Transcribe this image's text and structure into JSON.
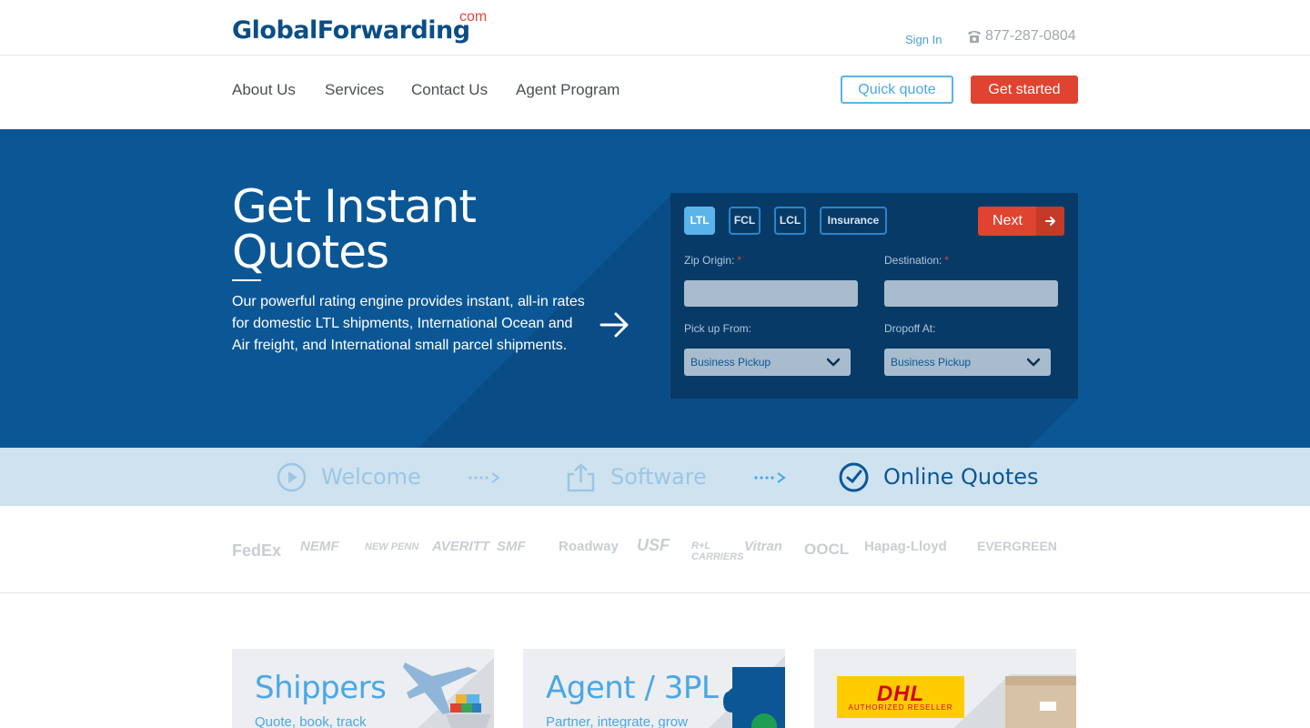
{
  "header": {
    "logo_text": "GlobalForwarding",
    "logo_suffix": "com",
    "sign_in": "Sign In",
    "phone": "877-287-0804"
  },
  "nav": {
    "items": [
      "About Us",
      "Services",
      "Contact Us",
      "Agent Program"
    ],
    "quick_quote": "Quick quote",
    "get_started": "Get started"
  },
  "hero": {
    "title_line1": "Get Instant",
    "title_line2": "Quotes",
    "description": "Our powerful rating engine provides instant, all-in rates for domestic LTL shipments, International Ocean and Air freight, and International small parcel shipments."
  },
  "quote_form": {
    "tabs": [
      "LTL",
      "FCL",
      "LCL",
      "Insurance"
    ],
    "active_tab": "LTL",
    "next_label": "Next",
    "zip_origin_label": "Zip Origin:",
    "destination_label": "Destination:",
    "required_mark": "*",
    "zip_origin_value": "",
    "destination_value": "",
    "pickup_label": "Pick up From:",
    "dropoff_label": "Dropoff At:",
    "pickup_value": "Business Pickup",
    "dropoff_value": "Business Pickup"
  },
  "steps": [
    {
      "label": "Welcome",
      "icon": "play-icon",
      "state": "inactive"
    },
    {
      "label": "Software",
      "icon": "share-icon",
      "state": "inactive"
    },
    {
      "label": "Online Quotes",
      "icon": "clock-icon",
      "state": "active"
    }
  ],
  "carriers": [
    "FedEx",
    "NEMF",
    "NEW PENN",
    "AVERITT",
    "SMF",
    "Roadway",
    "USF",
    "R+L CARRIERS",
    "Vitran",
    "OOCL",
    "Hapag-Lloyd",
    "EVERGREEN"
  ],
  "cards": [
    {
      "title": "Shippers",
      "subtitle": "Quote, book, track"
    },
    {
      "title": "Agent / 3PL",
      "subtitle": "Partner, integrate, grow"
    },
    {
      "badge": "DHL",
      "badge_sub": "AUTHORIZED RESELLER"
    }
  ],
  "colors": {
    "brand_blue": "#0b5796",
    "accent_red": "#e0432f",
    "light_blue": "#4aa8e4",
    "panel_dark": "#083a68"
  }
}
